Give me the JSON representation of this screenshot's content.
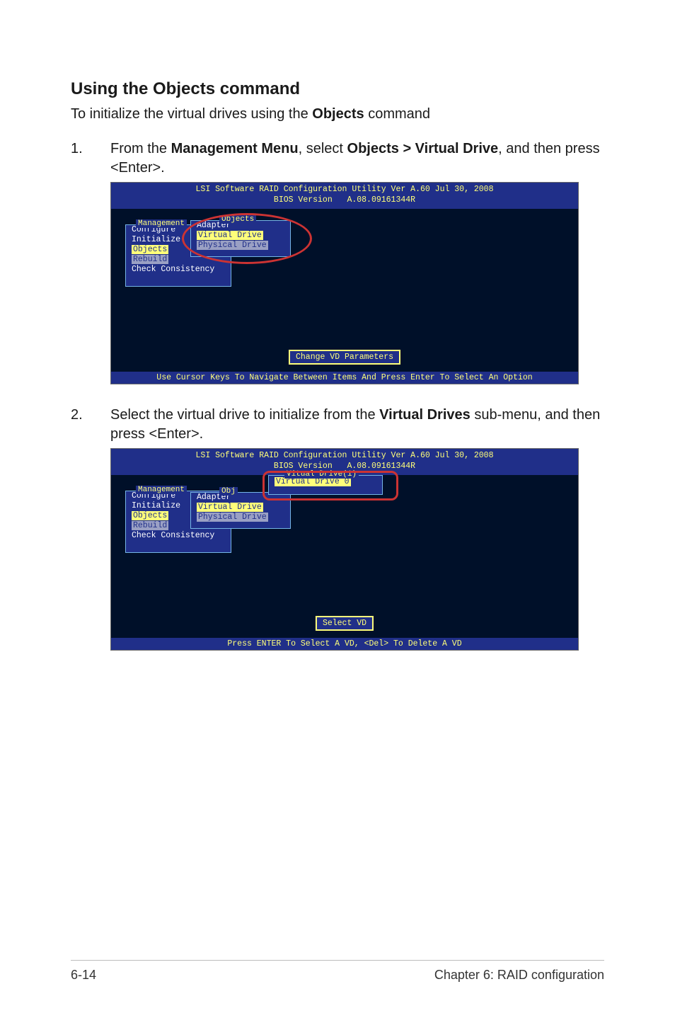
{
  "heading": "Using the Objects command",
  "lead_prefix": "To initialize the virtual drives using the ",
  "objects_word": "Objects",
  "lead_suffix": " command",
  "step1": {
    "num": "1.",
    "p1": "From the ",
    "mm": "Management Menu",
    "p2": ", select ",
    "path": "Objects > Virtual Drive",
    "p3": ", and then press <Enter>."
  },
  "step2": {
    "num": "2.",
    "p1": "Select the virtual drive to initialize from the ",
    "vd": "Virtual Drives",
    "p2": " sub-menu, and then press <Enter>."
  },
  "bios": {
    "header_line1": "LSI Software RAID Configuration Utility Ver A.60 Jul 30, 2008",
    "header_line2": "BIOS Version   A.08.09161344R",
    "mgmt_title": "Management",
    "mgmt_items": [
      "Configure",
      "Initialize",
      "Objects",
      "Rebuild",
      "Check Consistency"
    ],
    "objects_title": "Objects",
    "objects_title_short": "Obj",
    "objects_items": [
      "Adapter",
      "Virtual Drive",
      "Physical Drive"
    ],
    "vd_panel_title": "Vitual Drive(1)",
    "vd_panel_item": "Virtual Drive 0",
    "status1": "Change VD Parameters",
    "status2": "Select VD",
    "footer1": "Use Cursor Keys To Navigate Between Items And Press Enter To Select An Option",
    "footer2": "Press ENTER To Select A VD, <Del> To Delete A VD"
  },
  "page_footer": {
    "left": "6-14",
    "right": "Chapter 6: RAID configuration"
  }
}
